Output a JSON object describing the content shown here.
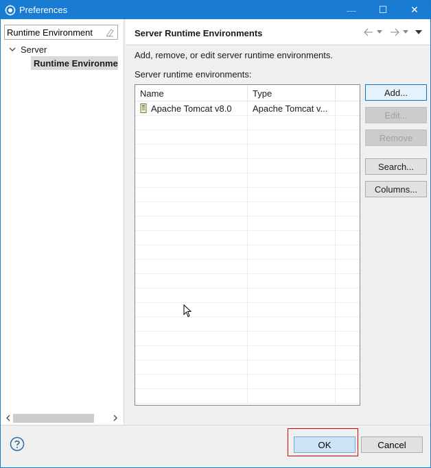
{
  "window": {
    "title": "Preferences",
    "controls": {
      "minimize": "—",
      "maximize": "☐",
      "close": "✕"
    }
  },
  "left_pane": {
    "filter": {
      "value": "Runtime Environment"
    },
    "tree": [
      {
        "label": "Server",
        "expanded": true
      },
      {
        "label": "Runtime Environme",
        "selected": true
      }
    ],
    "scroll_position": 0
  },
  "right_pane": {
    "title": "Server Runtime Environments",
    "description": "Add, remove, or edit server runtime environments.",
    "section_label": "Server runtime environments:",
    "table": {
      "columns": [
        "Name",
        "Type",
        ""
      ],
      "rows": [
        {
          "name": "Apache Tomcat v8.0",
          "type": "Apache Tomcat v..."
        }
      ]
    },
    "buttons": {
      "add": "Add...",
      "edit": "Edit...",
      "remove": "Remove",
      "search": "Search...",
      "columns": "Columns..."
    }
  },
  "footer": {
    "ok": "OK",
    "cancel": "Cancel"
  },
  "colors": {
    "titlebar": "#1a7bd3",
    "highlight": "#e00000",
    "selection": "#d9d9d9"
  }
}
